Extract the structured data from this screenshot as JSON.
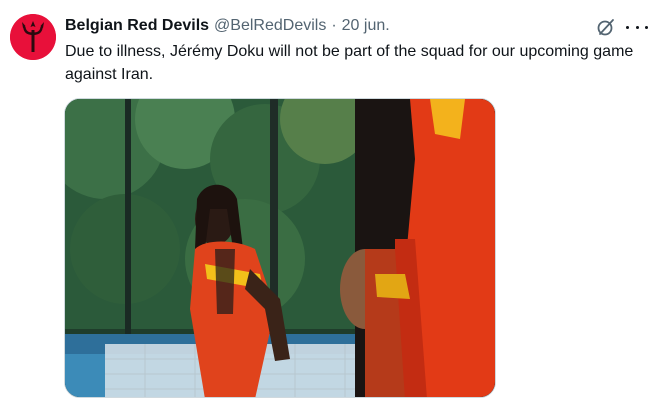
{
  "account": {
    "display_name": "Belgian Red Devils",
    "handle": "@BelRedDevils",
    "separator": "·",
    "date": "20 jun.",
    "avatar_icon": "red-devils-trident-icon",
    "avatar_color": "#e8103a"
  },
  "tweet": {
    "text": "Due to illness, Jérémy Doku will not be part of the squad for our upcoming game against Iran."
  },
  "actions": {
    "grok_icon": "grok-icon",
    "more_icon": "more-options-icon"
  },
  "colors": {
    "text_primary": "#0f1419",
    "text_secondary": "#536471",
    "border": "#cfd9de"
  }
}
